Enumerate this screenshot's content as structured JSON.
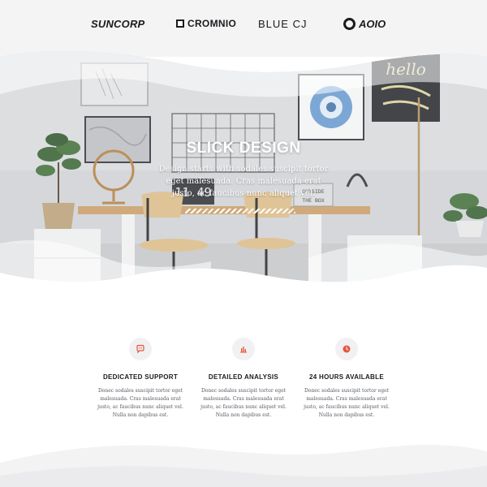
{
  "logos": {
    "suncorp": "SUNCORP",
    "cromnio": "CROMNIO",
    "bluecj": "BLUE CJ",
    "aoio": "AOIO"
  },
  "hero": {
    "title": "SLICK DESIGN",
    "text": "Design starts with sodales suscipit tortor eget malesuada. Cras malesuada erat justo, ac faucibus nunc aliquet vel.",
    "clock": "11 49",
    "box_sign_line1": "OUTSIDE",
    "box_sign_line2": "THE BOX",
    "poster_text": "hello"
  },
  "features": [
    {
      "icon": "chat-bubble-icon",
      "title": "DEDICATED SUPPORT",
      "desc": "Donec sodales suscipit tortor eget malesuada. Cras malesuada erat justo, ac faucibus nunc aliquet vel. Nulla non dapibus est."
    },
    {
      "icon": "bar-chart-icon",
      "title": "DETAILED ANALYSIS",
      "desc": "Donec sodales suscipit tortor eget malesuada. Cras malesuada erat justo, ac faucibus nunc aliquet vel. Nulla non dapibus est."
    },
    {
      "icon": "clock-icon",
      "title": "24 HOURS AVAILABLE",
      "desc": "Donec sodales suscipit tortor eget malesuada. Cras malesuada erat justo, ac faucibus nunc aliquet vel. Nulla non dapibus est."
    }
  ],
  "colors": {
    "accent": "#e8553c",
    "icon_bg": "#f1f1f3",
    "logo_bar_bg": "#f4f4f5"
  }
}
